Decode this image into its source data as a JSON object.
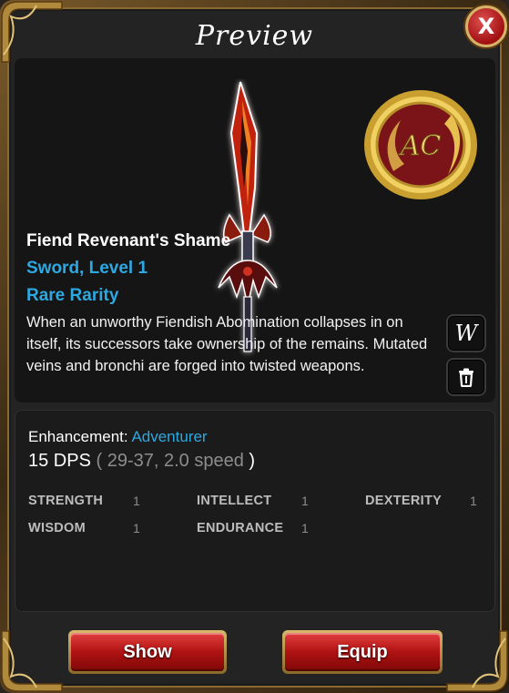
{
  "window": {
    "title": "Preview",
    "close_label": "X"
  },
  "item": {
    "name": "Fiend Revenant's Shame",
    "type_level": "Sword, Level 1",
    "rarity": "Rare Rarity",
    "description": "When an unworthy Fiendish Abomination collapses in on itself, its successors take ownership of the remains. Mutated veins and bronchi are forged into twisted weapons.",
    "badge_text": "AC",
    "badge_icon": "ac-coin-icon"
  },
  "side_buttons": {
    "wiki_label": "W",
    "trash_icon": "trash-icon"
  },
  "stats": {
    "enhancement_label": "Enhancement:",
    "enhancement_value": "Adventurer",
    "dps_main": "15 DPS",
    "dps_open": "(",
    "dps_detail": "29-37, 2.0 speed",
    "dps_close": ")",
    "attributes": [
      {
        "label": "STRENGTH",
        "value": "1"
      },
      {
        "label": "INTELLECT",
        "value": "1"
      },
      {
        "label": "DEXTERITY",
        "value": "1"
      },
      {
        "label": "WISDOM",
        "value": "1"
      },
      {
        "label": "ENDURANCE",
        "value": "1"
      }
    ]
  },
  "actions": {
    "show_label": "Show",
    "equip_label": "Equip"
  },
  "colors": {
    "accent_blue": "#2ea8e0",
    "button_red": "#b01212",
    "gold": "#d7b36a"
  }
}
